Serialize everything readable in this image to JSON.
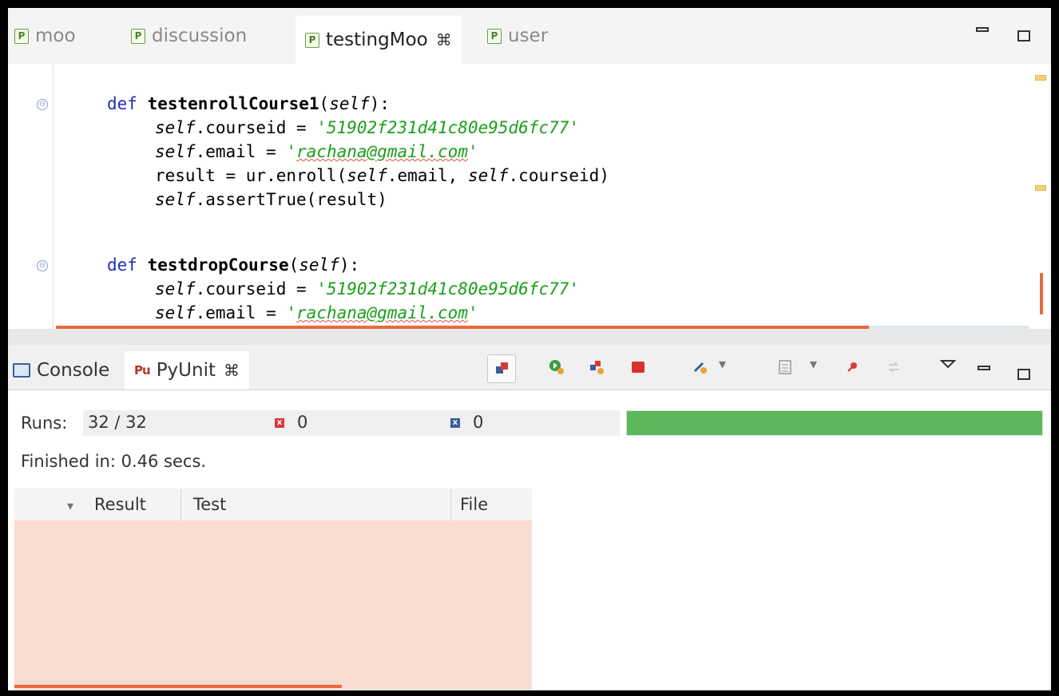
{
  "editor_tabs": [
    {
      "label": "moo",
      "active": false
    },
    {
      "label": "discussion",
      "active": false
    },
    {
      "label": "testingMoo",
      "active": true,
      "close": "⌘"
    },
    {
      "label": "user",
      "active": false
    }
  ],
  "tab_icon_letter": "P",
  "code": {
    "line1": {
      "kw": "def",
      "fn": "testenrollCourse1",
      "open": "(",
      "self": "self",
      "close": "):"
    },
    "line2": {
      "self": "self",
      "rest": ".courseid = ",
      "str": "'51902f231d41c80e95d6fc77'"
    },
    "line3": {
      "self": "self",
      "rest": ".email = ",
      "q1": "'",
      "str": "rachana@gmail.com",
      "q2": "'"
    },
    "line4": {
      "a": "result = ur.enroll(",
      "self1": "self",
      "b": ".email, ",
      "self2": "self",
      "c": ".courseid)"
    },
    "line5": {
      "self": "self",
      "rest": ".assertTrue(result)"
    },
    "line6": {
      "kw": "def",
      "fn": "testdropCourse",
      "open": "(",
      "self": "self",
      "close": "):"
    },
    "line7": {
      "self": "self",
      "rest": ".courseid = ",
      "str": "'51902f231d41c80e95d6fc77'"
    },
    "line8": {
      "self": "self",
      "rest": ".email = ",
      "q1": "'",
      "str": "rachana@gmail.com",
      "q2": "'"
    }
  },
  "panel_tabs": [
    {
      "label": "Console",
      "active": false
    },
    {
      "label": "PyUnit",
      "active": true,
      "close": "⌘",
      "icon_text": "Pu"
    }
  ],
  "pyunit": {
    "runs_label": "Runs:",
    "runs_value": "32 / 32",
    "errors": "0",
    "failures": "0",
    "progress": 1.0,
    "progress_color": "#5cb85c",
    "finished": "Finished in: 0.46 secs.",
    "columns": [
      "Result",
      "Test",
      "File"
    ],
    "error_icon_text": "x"
  },
  "colors": {
    "keyword": "#1f2eb5",
    "string": "#1aa01a",
    "failure_bg": "#f9dcd1",
    "scroll_accent": "#e86a3a"
  },
  "icons": {
    "fold": "⊖",
    "dropdown": "▾",
    "column_dropdown": "▾"
  }
}
